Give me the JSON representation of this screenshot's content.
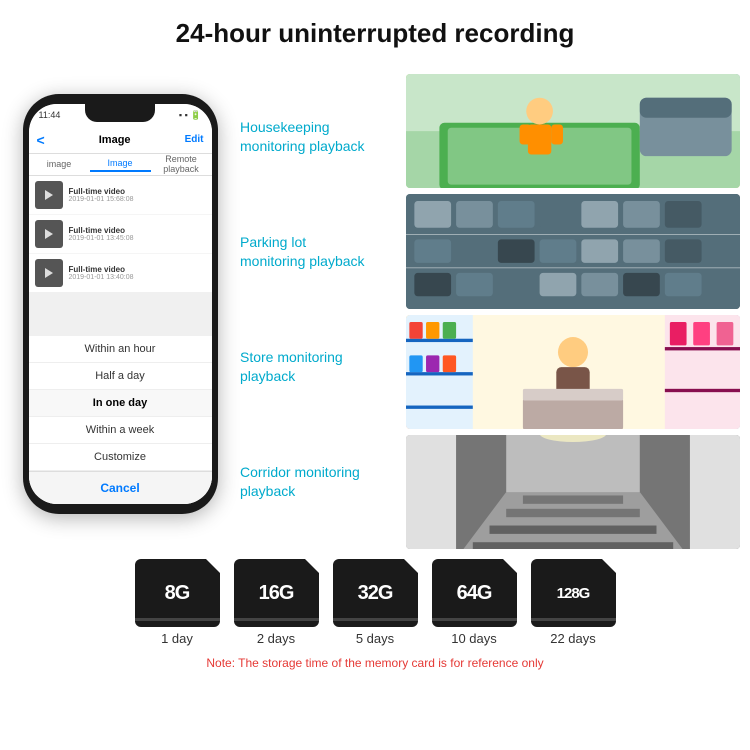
{
  "header": {
    "title": "24-hour uninterrupted recording"
  },
  "phone": {
    "time": "11:44",
    "screen_title": "Image",
    "edit_label": "Edit",
    "back_symbol": "<",
    "tabs": [
      "image",
      "Image",
      "Remote playback"
    ],
    "active_tab": 1,
    "videos": [
      {
        "title": "Full-time video",
        "date": "2019-01-01 15:68:08"
      },
      {
        "title": "Full-time video",
        "date": "2019-01-01 13:45:08"
      },
      {
        "title": "Full-time video",
        "date": "2019-01-01 13:40:08"
      }
    ],
    "dropdown_items": [
      "Within an hour",
      "Half a day",
      "In one day",
      "Within a week",
      "Customize"
    ],
    "selected_item": "In one day",
    "cancel_label": "Cancel"
  },
  "monitoring_labels": [
    "Housekeeping\nmonitoring playback",
    "Parking lot\nmonitoring playback",
    "Store monitoring\nplayback",
    "Corridor monitoring\nplayback"
  ],
  "sd_cards": [
    {
      "size": "8G",
      "days": "1 day"
    },
    {
      "size": "16G",
      "days": "2 days"
    },
    {
      "size": "32G",
      "days": "5 days"
    },
    {
      "size": "64G",
      "days": "10 days"
    },
    {
      "size": "128G",
      "days": "22 days"
    }
  ],
  "note": "Note: The storage time of the memory card is for reference only"
}
